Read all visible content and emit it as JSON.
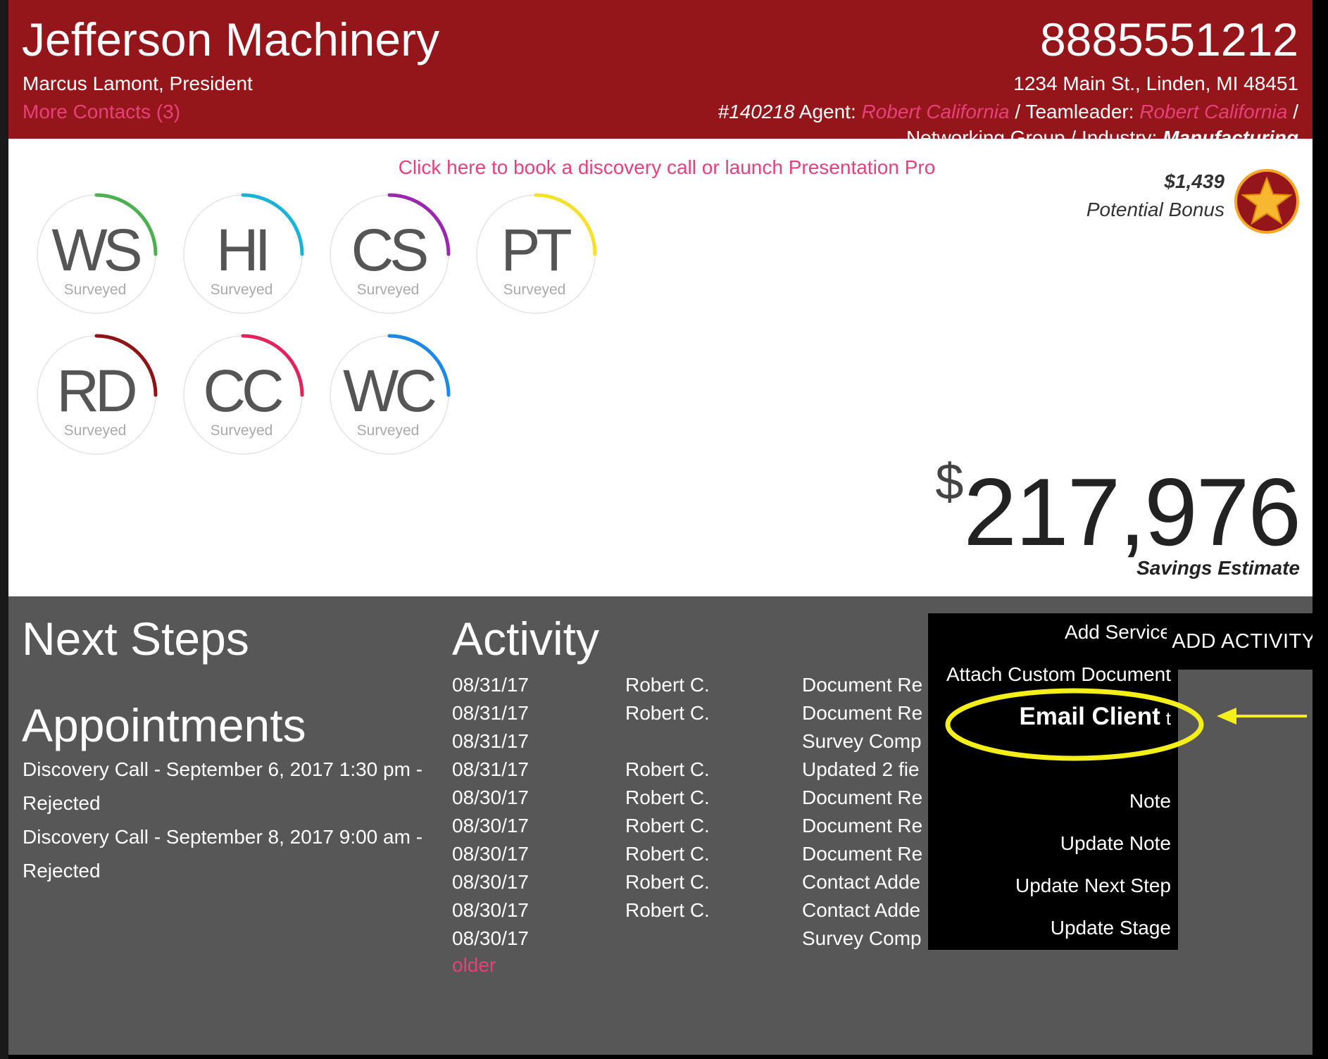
{
  "header": {
    "company": "Jefferson Machinery",
    "contact": "Marcus Lamont, President",
    "more_contacts": "More Contacts (3)",
    "phone": "8885551212",
    "address": "1234 Main St., Linden, MI 48451",
    "account_number": "#140218",
    "agent_label": "Agent:",
    "agent_name": "Robert California",
    "separator1": "/",
    "teamleader_label": "Teamleader:",
    "teamleader_name": "Robert California",
    "separator2": "/",
    "group_label": "Networking Group /",
    "industry_label": "Industry:",
    "industry_value": "Manufacturing"
  },
  "panel": {
    "book_link": "Click here to book a discovery call or launch Presentation Pro",
    "bonus_amount": "$1,439",
    "bonus_label": "Potential Bonus",
    "savings_symbol": "$",
    "savings_value": "217,976",
    "savings_label": "Savings Estimate"
  },
  "gauges": [
    {
      "abbr": "WS",
      "status": "Surveyed",
      "color": "#4caf50",
      "progress": 0.25
    },
    {
      "abbr": "HI",
      "status": "Surveyed",
      "color": "#1ab3d6",
      "progress": 0.25
    },
    {
      "abbr": "CS",
      "status": "Surveyed",
      "color": "#9b27af",
      "progress": 0.25
    },
    {
      "abbr": "PT",
      "status": "Surveyed",
      "color": "#f5e12a",
      "progress": 0.25
    },
    {
      "abbr": "RD",
      "status": "Surveyed",
      "color": "#8e1416",
      "progress": 0.25
    },
    {
      "abbr": "CC",
      "status": "Surveyed",
      "color": "#e0245e",
      "progress": 0.25
    },
    {
      "abbr": "WC",
      "status": "Surveyed",
      "color": "#1e88e5",
      "progress": 0.25
    }
  ],
  "next_steps": {
    "title": "Next Steps"
  },
  "appointments": {
    "title": "Appointments",
    "lines": [
      "Discovery Call - September 6, 2017 1:30 pm -",
      "Rejected",
      "Discovery Call - September 8, 2017 9:00 am -",
      "Rejected"
    ]
  },
  "activity": {
    "title": "Activity",
    "rows": [
      {
        "date": "08/31/17",
        "who": "Robert C.",
        "what": "Document Re"
      },
      {
        "date": "08/31/17",
        "who": "Robert C.",
        "what": "Document Re"
      },
      {
        "date": "08/31/17",
        "who": "",
        "what": "Survey Comp"
      },
      {
        "date": "08/31/17",
        "who": "Robert C.",
        "what": "Updated 2 fie"
      },
      {
        "date": "08/30/17",
        "who": "Robert C.",
        "what": "Document Re"
      },
      {
        "date": "08/30/17",
        "who": "Robert C.",
        "what": "Document Re"
      },
      {
        "date": "08/30/17",
        "who": "Robert C.",
        "what": "Document Re"
      },
      {
        "date": "08/30/17",
        "who": "Robert C.",
        "what": "Contact Adde"
      },
      {
        "date": "08/30/17",
        "who": "Robert C.",
        "what": "Contact Adde"
      },
      {
        "date": "08/30/17",
        "who": "",
        "what": "Survey Comp"
      }
    ],
    "older": "older"
  },
  "menu": {
    "button_label": "ADD ACTIVITY",
    "items": [
      "Add Service",
      "Attach Custom Document",
      "Email Client",
      "Note",
      "Update Note",
      "Update Next Step",
      "Update Stage"
    ],
    "email_suffix": "t"
  },
  "colors": {
    "header_bg": "#95161a",
    "accent_pink": "#e8407a",
    "lower_bg": "#575757",
    "highlight": "#f5ef19"
  }
}
